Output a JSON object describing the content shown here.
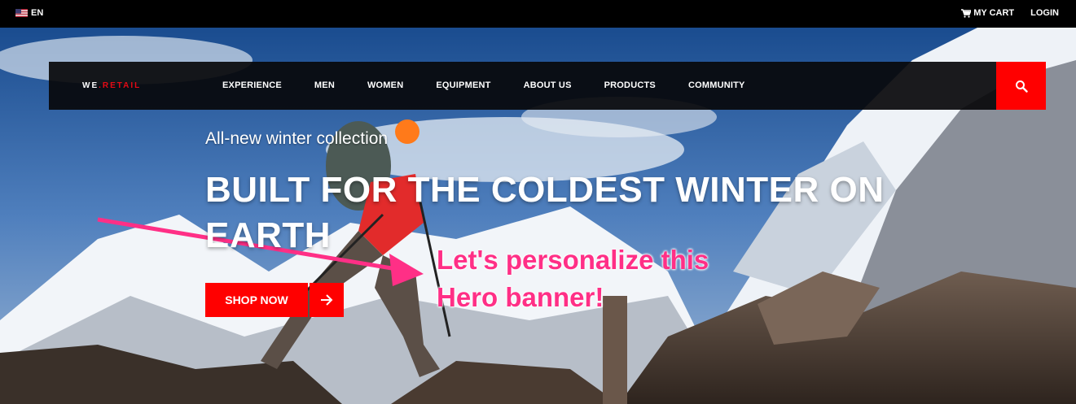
{
  "topbar": {
    "language": "EN",
    "cart_label": "MY CART",
    "login_label": "LOGIN"
  },
  "brand": {
    "name_part1": "WE",
    "separator": ".",
    "name_part2": "RETAIL"
  },
  "nav": {
    "items": [
      "EXPERIENCE",
      "MEN",
      "WOMEN",
      "EQUIPMENT",
      "ABOUT US",
      "PRODUCTS",
      "COMMUNITY"
    ]
  },
  "hero": {
    "kicker": "All-new winter collection",
    "headline": "BUILT FOR THE COLDEST WINTER ON EARTH",
    "cta_label": "SHOP NOW"
  },
  "annotation": {
    "text": "Let's personalize this\nHero banner!"
  },
  "colors": {
    "accent": "#ff0000",
    "annotation": "#ff2f86"
  },
  "icons": [
    "us-flag-icon",
    "cart-icon",
    "search-icon",
    "arrow-right-icon"
  ]
}
